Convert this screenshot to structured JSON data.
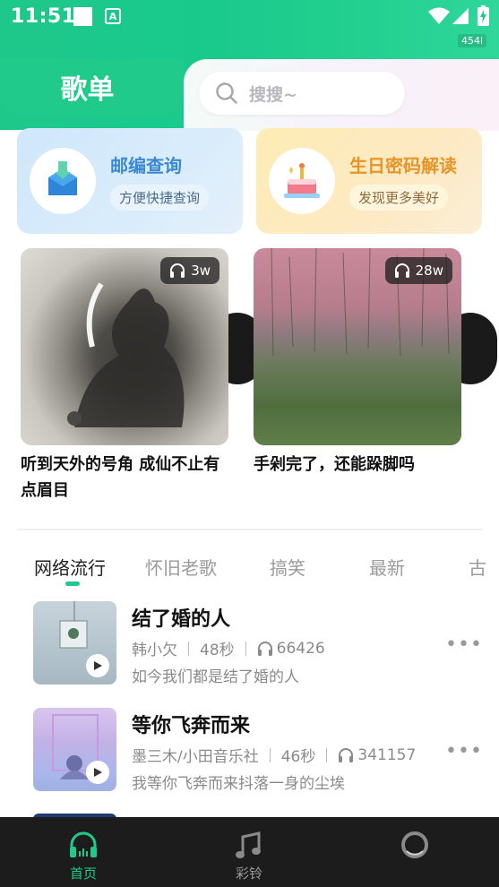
{
  "status_bar": {
    "time": "11:51",
    "a_icon_letter": "A",
    "net_speed": "454l"
  },
  "header": {
    "title": "歌单",
    "search_placeholder": "搜搜~"
  },
  "features": [
    {
      "title": "邮编查询",
      "subtitle": "方便快捷查询",
      "icon": "mailbox-icon"
    },
    {
      "title": "生日密码解读",
      "subtitle": "发现更多美好",
      "icon": "cake-icon"
    }
  ],
  "playlists": [
    {
      "title": "听到天外的号角 成仙不止有点眉目",
      "play_count": "3w"
    },
    {
      "title": "手剁完了，还能跺脚吗",
      "play_count": "28w"
    }
  ],
  "tabs": [
    {
      "label": "网络流行",
      "active": true
    },
    {
      "label": "怀旧老歌",
      "active": false
    },
    {
      "label": "搞笑",
      "active": false
    },
    {
      "label": "最新",
      "active": false
    },
    {
      "label": "古",
      "active": false
    }
  ],
  "songs": [
    {
      "title": "结了婚的人",
      "artist": "韩小欠",
      "duration": "48秒",
      "plays": "66426",
      "desc": "如今我们都是结了婚的人"
    },
    {
      "title": "等你飞奔而来",
      "artist": "墨三木/小田音乐社",
      "duration": "46秒",
      "plays": "341157",
      "desc": "我等你飞奔而来抖落一身的尘埃"
    }
  ],
  "more_glyph": "•••",
  "bottom_nav": [
    {
      "label": "首页",
      "icon": "headphones-icon",
      "active": true
    },
    {
      "label": "彩铃",
      "icon": "music-note-icon",
      "active": false
    },
    {
      "label": "",
      "icon": "ring-icon",
      "active": false
    }
  ],
  "colors": {
    "accent": "#21c98c",
    "postal_title": "#3b89d2",
    "birthday_title": "#e79428",
    "nav_bg": "#1c1c1c"
  }
}
